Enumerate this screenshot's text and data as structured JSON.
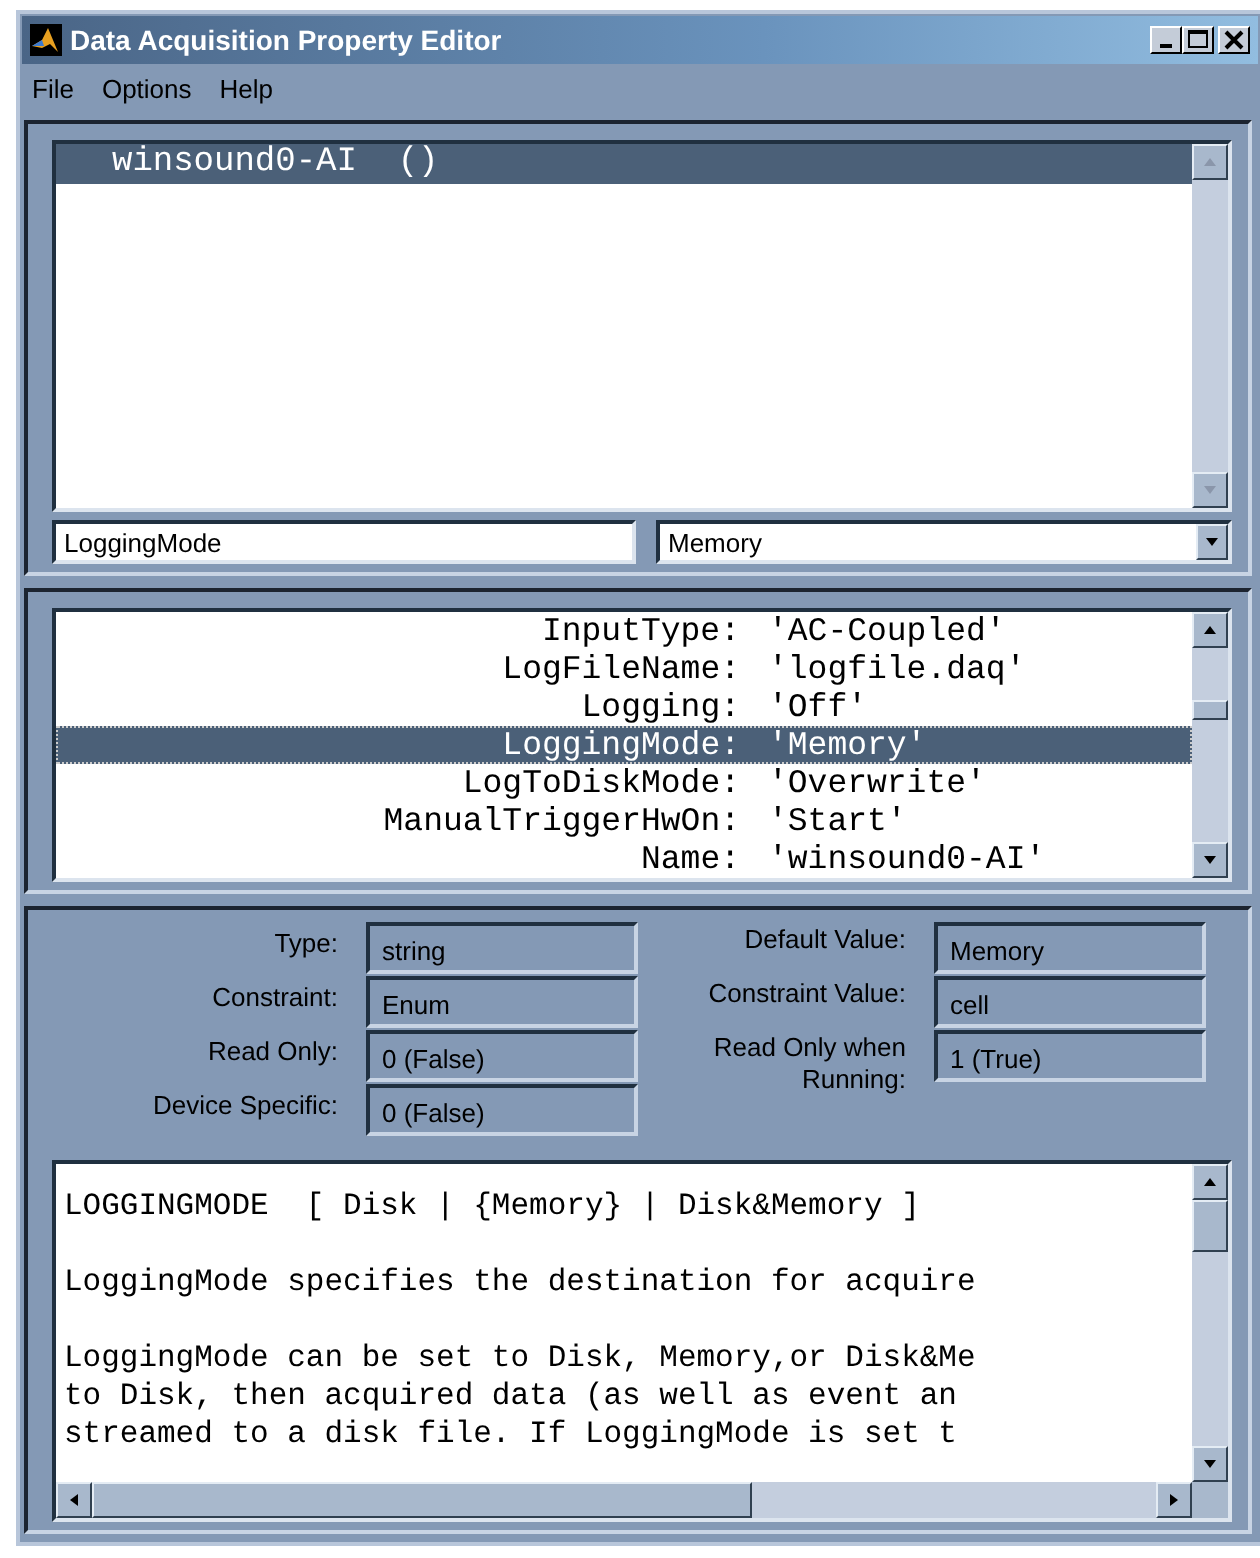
{
  "window": {
    "title": "Data Acquisition Property Editor"
  },
  "menu": [
    "File",
    "Options",
    "Help"
  ],
  "objects": [
    {
      "label": "winsound0-AI  ()",
      "selected": true
    }
  ],
  "property_field": {
    "value": "LoggingMode"
  },
  "value_dropdown": {
    "value": "Memory"
  },
  "properties": [
    {
      "name": "InputType:",
      "value": "'AC-Coupled'",
      "selected": false
    },
    {
      "name": "LogFileName:",
      "value": "'logfile.daq'",
      "selected": false
    },
    {
      "name": "Logging:",
      "value": "'Off'",
      "selected": false
    },
    {
      "name": "LoggingMode:",
      "value": "'Memory'",
      "selected": true
    },
    {
      "name": "LogToDiskMode:",
      "value": "'Overwrite'",
      "selected": false
    },
    {
      "name": "ManualTriggerHwOn:",
      "value": "'Start'",
      "selected": false
    },
    {
      "name": "Name:",
      "value": "'winsound0-AI'",
      "selected": false
    }
  ],
  "info_left": [
    {
      "label": "Type:",
      "value": "string"
    },
    {
      "label": "Constraint:",
      "value": "Enum"
    },
    {
      "label": "Read Only:",
      "value": "0 (False)"
    },
    {
      "label": "Device Specific:",
      "value": "0 (False)"
    }
  ],
  "info_right": [
    {
      "label": "Default Value:",
      "value": "Memory"
    },
    {
      "label": "Constraint Value:",
      "value": "cell"
    },
    {
      "label": "Read Only when Running:",
      "value": "1 (True)"
    }
  ],
  "help_paragraphs": [
    [
      "LOGGINGMODE  [ Disk | {Memory} | Disk&Memory ]"
    ],
    [
      "LoggingMode specifies the destination for acquire"
    ],
    [
      "LoggingMode can be set to Disk, Memory,or Disk&Me",
      "to Disk, then acquired data (as well as event an",
      "streamed to a disk file. If LoggingMode is set t"
    ]
  ]
}
